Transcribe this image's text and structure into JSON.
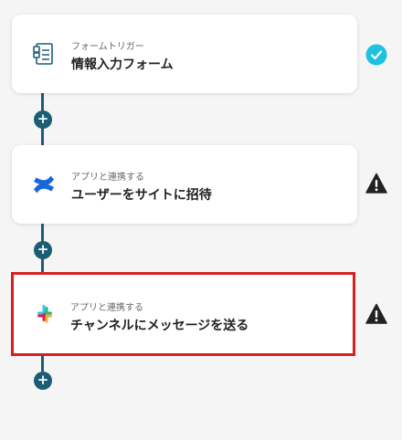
{
  "flow": {
    "steps": [
      {
        "label": "フォームトリガー",
        "title": "情報入力フォーム",
        "icon": "form-icon",
        "status": "check-icon"
      },
      {
        "label": "アプリと連携する",
        "title": "ユーザーをサイトに招待",
        "icon": "confluence-icon",
        "status": "warning-icon"
      },
      {
        "label": "アプリと連携する",
        "title": "チャンネルにメッセージを送る",
        "icon": "slack-icon",
        "status": "warning-icon"
      }
    ],
    "add_step_symbol": "+"
  },
  "colors": {
    "connector": "#1b5e73",
    "check": "#1ec1df",
    "warning": "#222222",
    "selected_border": "#d81f1f",
    "confluence": "#1868db"
  }
}
